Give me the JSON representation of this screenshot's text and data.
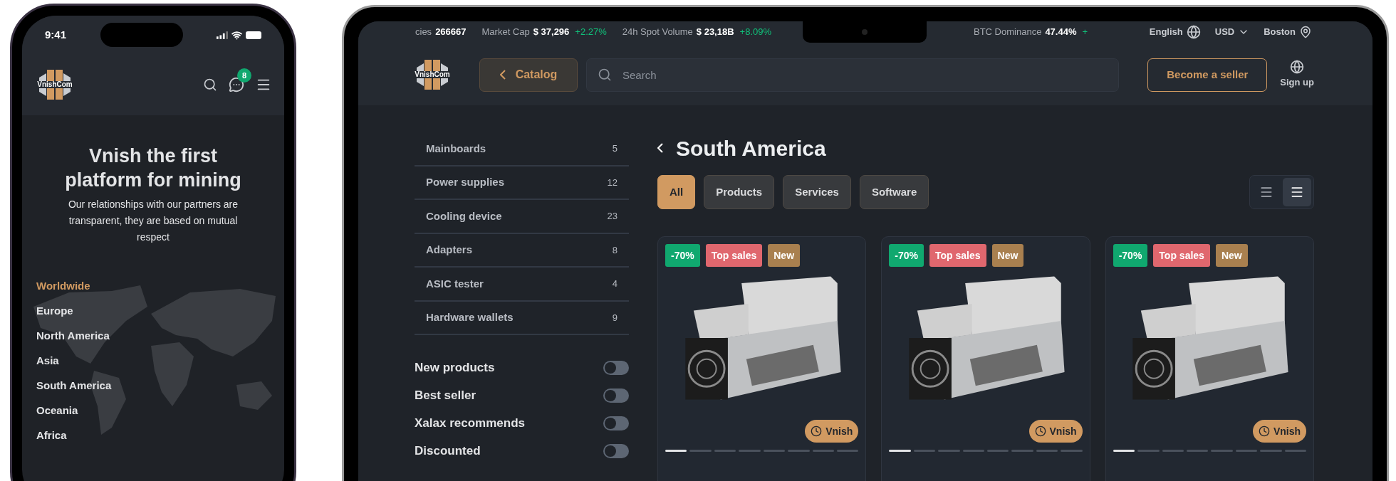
{
  "phone": {
    "status_bar": {
      "time": "9:41"
    },
    "header": {
      "logo_text": "VnishCom",
      "chat_badge": "8"
    },
    "hero": {
      "title": "Vnish the first platform for mining",
      "subtitle": "Our relationships with our partners are transparent, they are based on mutual respect"
    },
    "regions": [
      {
        "label": "Worldwide",
        "selected": true
      },
      {
        "label": "Europe",
        "selected": false
      },
      {
        "label": "North America",
        "selected": false
      },
      {
        "label": "Asia",
        "selected": false
      },
      {
        "label": "South America",
        "selected": false
      },
      {
        "label": "Oceania",
        "selected": false
      },
      {
        "label": "Africa",
        "selected": false
      }
    ]
  },
  "laptop": {
    "ticker": [
      {
        "label": "cies",
        "value": "266667"
      },
      {
        "label": "Market Cap",
        "value": "$ 37,296",
        "change": "+2.27%"
      },
      {
        "label": "24h Spot Volume",
        "value": "$ 23,18B",
        "change": "+8.09%"
      },
      {
        "label": "BTC Dominance",
        "value": "47.44%",
        "change": "+"
      }
    ],
    "locale": {
      "language": "English",
      "currency": "USD",
      "city": "Boston"
    },
    "header": {
      "logo_text": "VnishCom",
      "catalog_button": "Catalog",
      "search_placeholder": "Search",
      "seller_button": "Become a seller",
      "signup": "Sign up"
    },
    "sidebar": {
      "categories": [
        {
          "label": "Mainboards",
          "count": "5"
        },
        {
          "label": "Power supplies",
          "count": "12"
        },
        {
          "label": "Cooling device",
          "count": "23"
        },
        {
          "label": "Adapters",
          "count": "8"
        },
        {
          "label": "ASIC tester",
          "count": "4"
        },
        {
          "label": "Hardware wallets",
          "count": "9"
        }
      ],
      "filters": [
        {
          "label": "New products",
          "on": false
        },
        {
          "label": "Best seller",
          "on": false
        },
        {
          "label": "Xalax recommends",
          "on": false
        },
        {
          "label": "Discounted",
          "on": false
        }
      ]
    },
    "title": "South America",
    "tabs": [
      {
        "label": "All",
        "selected": true
      },
      {
        "label": "Products",
        "selected": false
      },
      {
        "label": "Services",
        "selected": false
      },
      {
        "label": "Software",
        "selected": false
      }
    ],
    "view_modes": [
      {
        "selected": false
      },
      {
        "selected": true
      }
    ],
    "cards": [
      {
        "badges": [
          {
            "label": "-70%",
            "color": "#10a86f"
          },
          {
            "label": "Top sales",
            "color": "#e0676e"
          },
          {
            "label": "New",
            "color": "#a9804f"
          }
        ],
        "seller": "Vnish",
        "slides": [
          {
            "selected": true
          },
          {
            "selected": false
          },
          {
            "selected": false
          },
          {
            "selected": false
          },
          {
            "selected": false
          },
          {
            "selected": false
          },
          {
            "selected": false
          },
          {
            "selected": false
          }
        ]
      },
      {
        "badges": [
          {
            "label": "-70%",
            "color": "#10a86f"
          },
          {
            "label": "Top sales",
            "color": "#e0676e"
          },
          {
            "label": "New",
            "color": "#a9804f"
          }
        ],
        "seller": "Vnish",
        "slides": [
          {
            "selected": true
          },
          {
            "selected": false
          },
          {
            "selected": false
          },
          {
            "selected": false
          },
          {
            "selected": false
          },
          {
            "selected": false
          },
          {
            "selected": false
          },
          {
            "selected": false
          }
        ]
      },
      {
        "badges": [
          {
            "label": "-70%",
            "color": "#10a86f"
          },
          {
            "label": "Top sales",
            "color": "#e0676e"
          },
          {
            "label": "New",
            "color": "#a9804f"
          }
        ],
        "seller": "Vnish",
        "slides": [
          {
            "selected": true
          },
          {
            "selected": false
          },
          {
            "selected": false
          },
          {
            "selected": false
          },
          {
            "selected": false
          },
          {
            "selected": false
          },
          {
            "selected": false
          },
          {
            "selected": false
          }
        ]
      }
    ]
  }
}
